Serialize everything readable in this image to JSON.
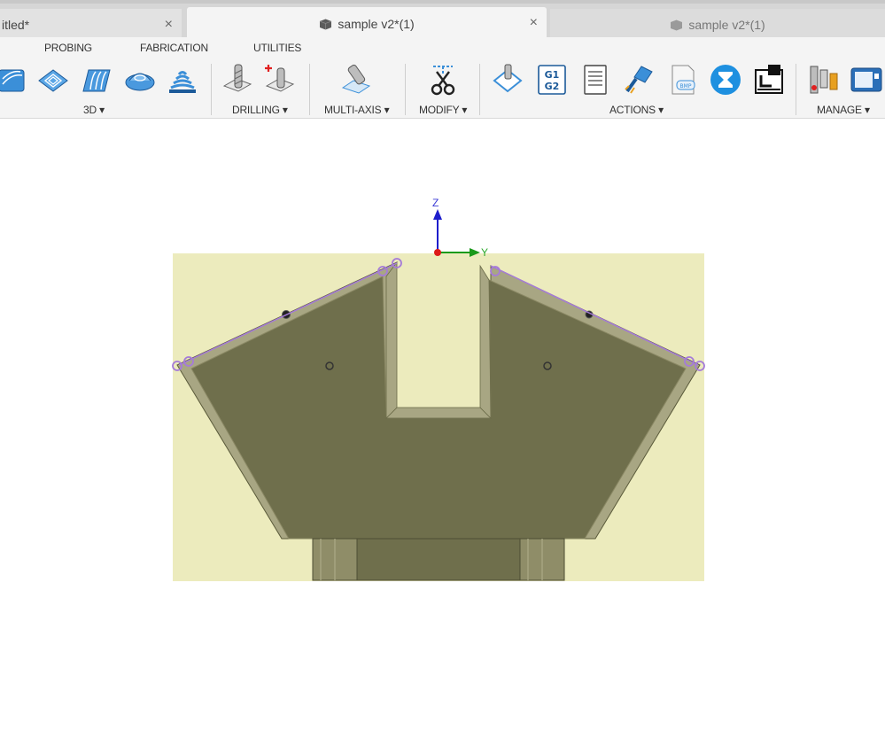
{
  "tabs": [
    {
      "label": "itled*",
      "close": "×"
    },
    {
      "label": "sample v2*(1)",
      "close": "×",
      "icon": "document-icon"
    },
    {
      "label": "sample v2*(1)",
      "icon": "document-icon"
    }
  ],
  "menu": [
    "PROBING",
    "FABRICATION",
    "UTILITIES"
  ],
  "groups": [
    {
      "label": "3D",
      "arrow": "▾"
    },
    {
      "label": "DRILLING",
      "arrow": "▾"
    },
    {
      "label": "MULTI-AXIS",
      "arrow": "▾"
    },
    {
      "label": "MODIFY",
      "arrow": "▾"
    },
    {
      "label": "ACTIONS",
      "arrow": "▾"
    },
    {
      "label": "MANAGE",
      "arrow": "▾"
    }
  ],
  "tools": {
    "g1g2_text": [
      "G1",
      "G2"
    ],
    "bmp_text": "BMP"
  },
  "axes": {
    "z": "Z",
    "y": "Y"
  },
  "colors": {
    "stock": "#ecebbd",
    "part_face": "#6f6f4c",
    "part_edge": "#a8a683",
    "accent_blue": "#1e90e0",
    "selection": "#a57bd8"
  }
}
